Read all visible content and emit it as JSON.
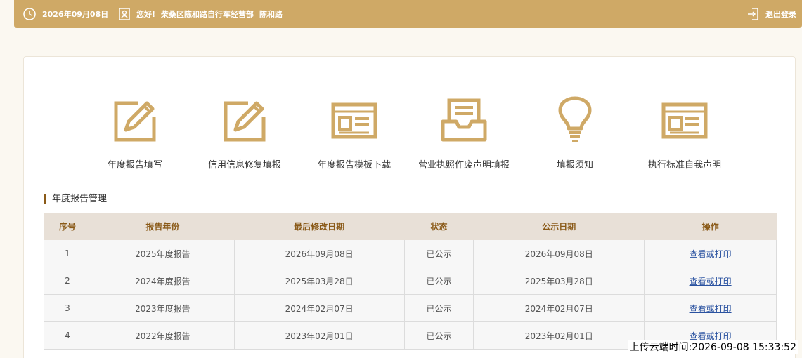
{
  "header": {
    "date": "2026年09月08日",
    "greeting": "您好!",
    "company": "柴桑区陈和路自行车经营部",
    "user": "陈和路",
    "logout": "退出登录"
  },
  "menu": [
    {
      "label": "年度报告填写",
      "icon": "edit-icon"
    },
    {
      "label": "信用信息修复填报",
      "icon": "edit-icon"
    },
    {
      "label": "年度报告模板下载",
      "icon": "template-icon"
    },
    {
      "label": "营业执照作废声明填报",
      "icon": "inbox-icon"
    },
    {
      "label": "填报须知",
      "icon": "lightbulb-icon"
    },
    {
      "label": "执行标准自我声明",
      "icon": "template-icon"
    }
  ],
  "section_title": "年度报告管理",
  "table": {
    "headers": [
      "序号",
      "报告年份",
      "最后修改日期",
      "状态",
      "公示日期",
      "操作"
    ],
    "rows": [
      [
        "1",
        "2025年度报告",
        "2026年09月08日",
        "已公示",
        "2026年09月08日",
        "查看或打印"
      ],
      [
        "2",
        "2024年度报告",
        "2025年03月28日",
        "已公示",
        "2025年03月28日",
        "查看或打印"
      ],
      [
        "3",
        "2023年度报告",
        "2024年02月07日",
        "已公示",
        "2024年02月07日",
        "查看或打印"
      ],
      [
        "4",
        "2022年度报告",
        "2023年02月01日",
        "已公示",
        "2023年02月01日",
        "查看或打印"
      ]
    ]
  },
  "upload_time": "上传云端时间:2026-09-08 15:33:52",
  "colors": {
    "accent": "#cfa966",
    "title_bar": "#8a5a18",
    "link": "#2a52a0"
  }
}
